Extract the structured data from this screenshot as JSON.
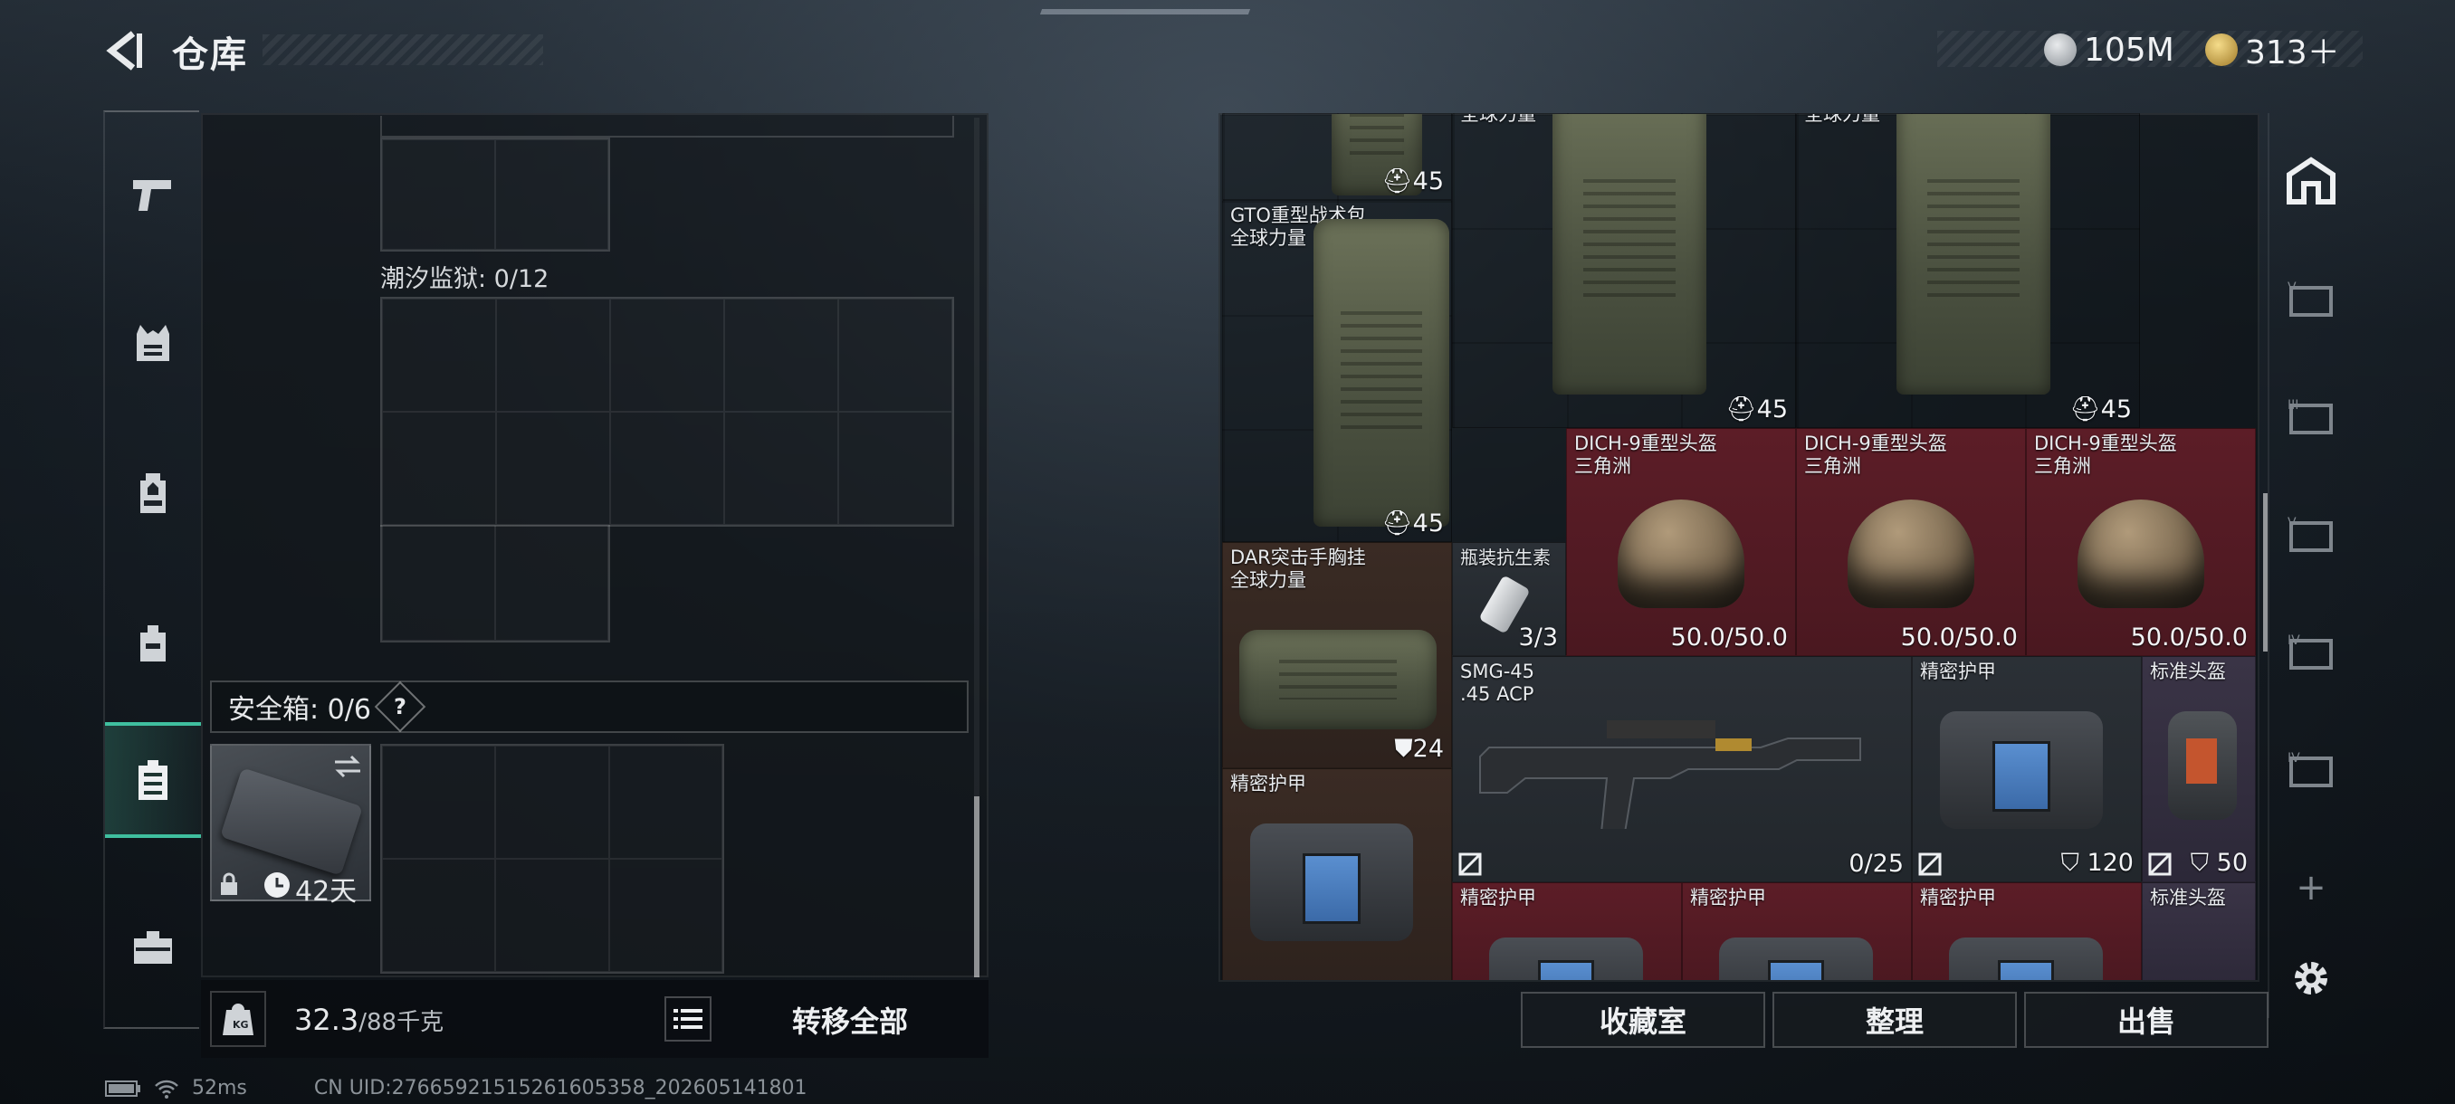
{
  "header": {
    "title": "仓库"
  },
  "currency": [
    {
      "value": "105M",
      "color": "#c8ccd0"
    },
    {
      "value": "313＋",
      "color": "#e0c070"
    }
  ],
  "nav": {
    "items": [
      "weapons",
      "armor-vest",
      "backpack",
      "bag",
      "case",
      "toolbox"
    ],
    "active": "case"
  },
  "left": {
    "tide_label": "潮汐监狱: 0/12",
    "safebox_label": "安全箱: 0/6",
    "help": "?",
    "case_days": "42天",
    "weight_value": "32.3",
    "weight_max": "/88千克",
    "transfer_all": "转移全部"
  },
  "items": [
    {
      "id": "bag-top-a",
      "name": "",
      "value": "45"
    },
    {
      "id": "bag-top-b",
      "name": "全球力量",
      "value": ""
    },
    {
      "id": "bag-top-c",
      "name": "全球力量",
      "value": ""
    },
    {
      "id": "gto",
      "name": "GTO重型战术包",
      "sub": "全球力量",
      "value": "45"
    },
    {
      "id": "gto-b",
      "value": "45"
    },
    {
      "id": "gto-c",
      "value": "45"
    },
    {
      "id": "h1",
      "name": "DICH-9重型头盔",
      "sub": "三角洲",
      "value": "50.0/50.0"
    },
    {
      "id": "h2",
      "name": "DICH-9重型头盔",
      "sub": "三角洲",
      "value": "50.0/50.0"
    },
    {
      "id": "h3",
      "name": "DICH-9重型头盔",
      "sub": "三角洲",
      "value": "50.0/50.0"
    },
    {
      "id": "dar",
      "name": "DAR突击手胸挂",
      "sub": "全球力量",
      "value": "24"
    },
    {
      "id": "antibiotic",
      "name": "瓶装抗生素",
      "value": "3/3"
    },
    {
      "id": "smg",
      "name": "SMG-45",
      "sub": ".45 ACP",
      "value": "0/25"
    },
    {
      "id": "armor1",
      "name": "精密护甲",
      "value": "120"
    },
    {
      "id": "stdhelm1",
      "name": "标准头盔",
      "value": "50"
    },
    {
      "id": "armor2",
      "name": "精密护甲",
      "value": ""
    },
    {
      "id": "armor3",
      "name": "精密护甲"
    },
    {
      "id": "armor4",
      "name": "精密护甲"
    },
    {
      "id": "armor5",
      "name": "精密护甲"
    },
    {
      "id": "stdhelm2",
      "name": "标准头盔"
    }
  ],
  "buttons": {
    "collection": "收藏室",
    "organize": "整理",
    "sell": "出售"
  },
  "rightbar": {
    "plus": "+"
  },
  "status": {
    "ping": "52ms",
    "uid": "CN UID:27665921515261605358_202605141801"
  }
}
